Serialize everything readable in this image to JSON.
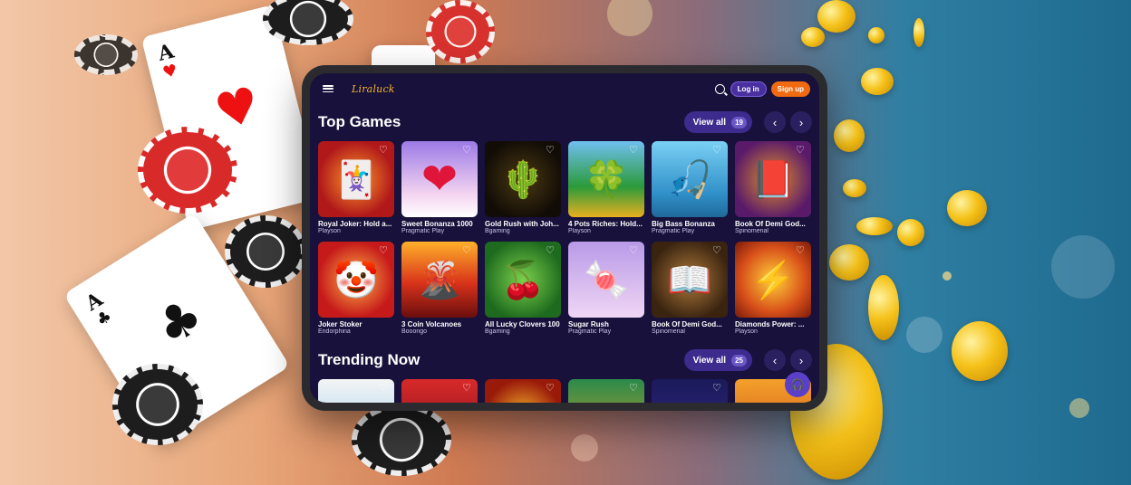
{
  "colors": {
    "screen_bg": "#17113b",
    "accent_purple": "#4a2fa0",
    "signup_orange": "#f06a12",
    "logo_gold": "#f4b52a"
  },
  "header": {
    "logo": "Liraluck",
    "menu_icon": "hamburger-icon",
    "search_icon": "search-icon",
    "login_label": "Log in",
    "signup_label": "Sign up"
  },
  "top_games": {
    "title": "Top Games",
    "view_all_label": "View all",
    "count": "19",
    "prev_icon": "‹",
    "next_icon": "›",
    "games": [
      {
        "title": "Royal Joker: Hold a...",
        "provider": "Playson"
      },
      {
        "title": "Sweet Bonanza 1000",
        "provider": "Pragmatic Play"
      },
      {
        "title": "Gold Rush with Joh...",
        "provider": "Bgaming"
      },
      {
        "title": "4 Pots Riches: Hold...",
        "provider": "Playson"
      },
      {
        "title": "Big Bass Bonanza",
        "provider": "Pragmatic Play"
      },
      {
        "title": "Book Of Demi God...",
        "provider": "Spinomenal"
      },
      {
        "title": "Joker Stoker",
        "provider": "Endorphina"
      },
      {
        "title": "3 Coin Volcanoes",
        "provider": "Booongo"
      },
      {
        "title": "All Lucky Clovers 100",
        "provider": "Bgaming"
      },
      {
        "title": "Sugar Rush",
        "provider": "Pragmatic Play"
      },
      {
        "title": "Book Of Demi God...",
        "provider": "Spinomenal"
      },
      {
        "title": "Diamonds Power: ...",
        "provider": "Playson"
      }
    ]
  },
  "trending": {
    "title": "Trending Now",
    "view_all_label": "View all",
    "count": "25",
    "prev_icon": "‹",
    "next_icon": "›"
  },
  "cards": {
    "ace_hearts": {
      "rank": "A",
      "suit": "♥"
    },
    "ace_clubs": {
      "rank": "A",
      "suit": "♣"
    }
  },
  "glyphs": {
    "heart": "♡",
    "support": "🎧"
  }
}
